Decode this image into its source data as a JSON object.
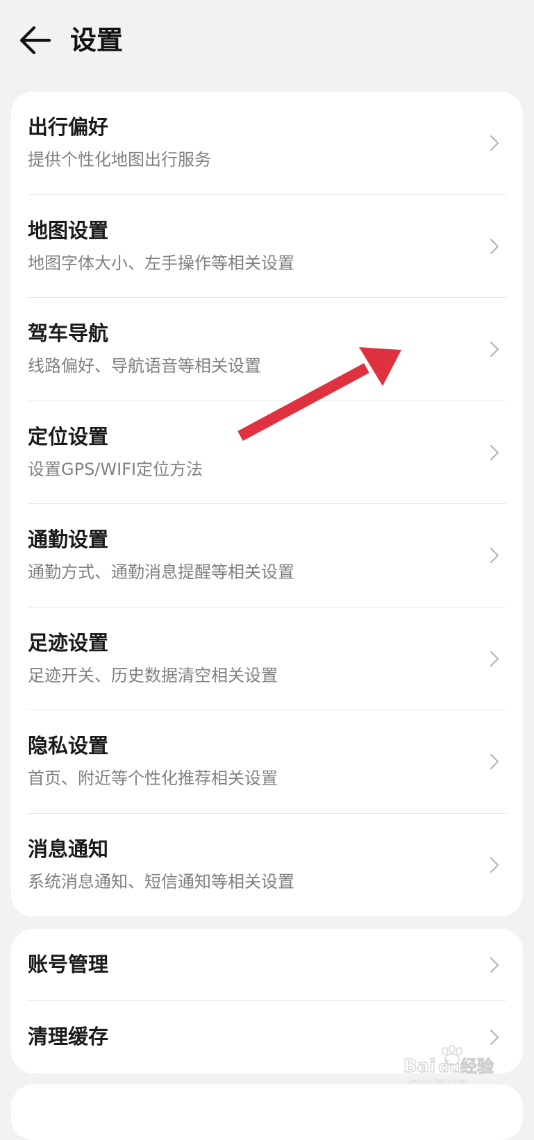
{
  "header": {
    "title": "设置",
    "back_icon": "arrow-left-icon"
  },
  "settings_card": {
    "items": [
      {
        "title": "出行偏好",
        "subtitle": "提供个性化地图出行服务"
      },
      {
        "title": "地图设置",
        "subtitle": "地图字体大小、左手操作等相关设置"
      },
      {
        "title": "驾车导航",
        "subtitle": "线路偏好、导航语音等相关设置"
      },
      {
        "title": "定位设置",
        "subtitle": "设置GPS/WIFI定位方法"
      },
      {
        "title": "通勤设置",
        "subtitle": "通勤方式、通勤消息提醒等相关设置"
      },
      {
        "title": "足迹设置",
        "subtitle": "足迹开关、历史数据清空相关设置"
      },
      {
        "title": "隐私设置",
        "subtitle": "首页、附近等个性化推荐相关设置"
      },
      {
        "title": "消息通知",
        "subtitle": "系统消息通知、短信通知等相关设置"
      }
    ]
  },
  "account_card": {
    "items": [
      {
        "title": "账号管理"
      },
      {
        "title": "清理缓存"
      }
    ]
  },
  "annotation": {
    "color": "#e0313f"
  },
  "watermark": {
    "text": "Bai du 经验",
    "sub": "jingyan.baidu.com"
  },
  "colors": {
    "background": "#f1f2f4",
    "card": "#ffffff",
    "title_text": "#1a1a1a",
    "subtitle_text": "#808080",
    "chevron": "#b5b5b5"
  }
}
